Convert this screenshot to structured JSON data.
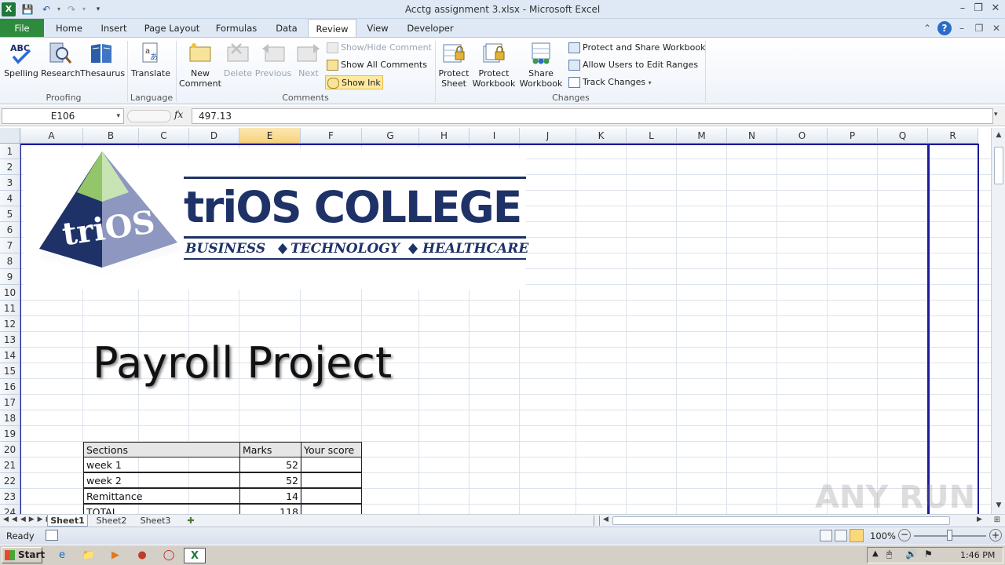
{
  "window": {
    "title": "Acctg assignment 3.xlsx - Microsoft Excel"
  },
  "tabs": [
    "File",
    "Home",
    "Insert",
    "Page Layout",
    "Formulas",
    "Data",
    "Review",
    "View",
    "Developer"
  ],
  "ribbon": {
    "proofing": {
      "spelling": "Spelling",
      "research": "Research",
      "thesaurus": "Thesaurus",
      "group": "Proofing"
    },
    "language": {
      "translate": "Translate",
      "group": "Language"
    },
    "comments": {
      "new_comment_1": "New",
      "new_comment_2": "Comment",
      "delete": "Delete",
      "previous": "Previous",
      "next": "Next",
      "show_hide": "Show/Hide Comment",
      "show_all": "Show All Comments",
      "show_ink": "Show Ink",
      "group": "Comments"
    },
    "changes": {
      "protect_sheet_1": "Protect",
      "protect_sheet_2": "Sheet",
      "protect_workbook_1": "Protect",
      "protect_workbook_2": "Workbook",
      "share_workbook_1": "Share",
      "share_workbook_2": "Workbook",
      "protect_share": "Protect and Share Workbook",
      "allow_users": "Allow Users to Edit Ranges",
      "track_changes": "Track Changes",
      "group": "Changes"
    }
  },
  "formula_bar": {
    "name_box": "E106",
    "fx": "fx",
    "value": "497.13"
  },
  "columns": [
    "A",
    "B",
    "C",
    "D",
    "E",
    "F",
    "G",
    "H",
    "I",
    "J",
    "K",
    "L",
    "M",
    "N",
    "O",
    "P",
    "Q",
    "R"
  ],
  "rows": [
    "1",
    "2",
    "3",
    "4",
    "5",
    "6",
    "7",
    "8",
    "9",
    "10",
    "11",
    "12",
    "13",
    "14",
    "15",
    "16",
    "17",
    "18",
    "19",
    "20",
    "21",
    "22",
    "23",
    "24"
  ],
  "logo": {
    "mark": "triOS",
    "name": "triOS COLLEGE",
    "tag_business": "BUSINESS",
    "tag_technology": "TECHNOLOGY",
    "tag_healthcare": "HEALTHCARE"
  },
  "heading": "Payroll Project",
  "table": {
    "headers": [
      "Sections",
      "Marks",
      "Your score"
    ],
    "rows": [
      {
        "section": "week 1",
        "marks": "52",
        "score": ""
      },
      {
        "section": "week 2",
        "marks": "52",
        "score": ""
      },
      {
        "section": "Remittance",
        "marks": "14",
        "score": ""
      },
      {
        "section": "TOTAL",
        "marks": "118",
        "score": ""
      }
    ]
  },
  "sheets": [
    "Sheet1",
    "Sheet2",
    "Sheet3"
  ],
  "status": {
    "ready": "Ready",
    "zoom": "100%"
  },
  "taskbar": {
    "start": "Start",
    "time": "1:46 PM"
  },
  "watermark": "ANY RUN"
}
